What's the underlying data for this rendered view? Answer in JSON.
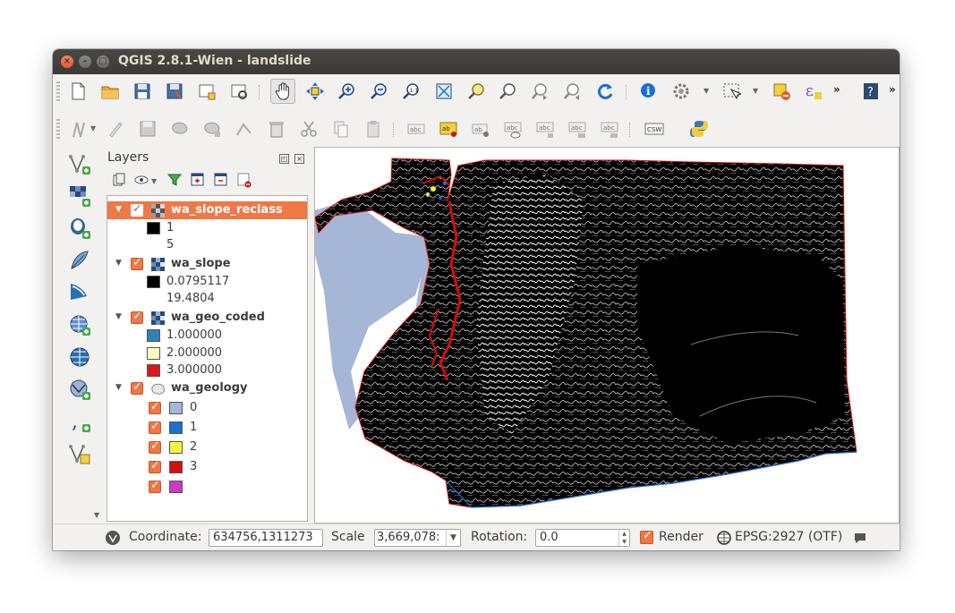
{
  "window": {
    "title": "QGIS 2.8.1-Wien - landslide"
  },
  "toolbar_icons": [
    "new-project-icon",
    "open-project-icon",
    "save-project-icon",
    "save-as-icon",
    "new-print-composer-icon",
    "composer-manager-icon",
    "pan-icon",
    "pan-to-selection-icon",
    "zoom-in-icon",
    "zoom-out-icon",
    "zoom-native-icon",
    "zoom-full-icon",
    "zoom-to-layer-icon",
    "zoom-last-icon",
    "zoom-next-icon",
    "refresh-icon",
    "identify-icon",
    "measure-icon",
    "select-icon",
    "deselect-icon",
    "epsilon-icon",
    "help-icon"
  ],
  "layers_panel": {
    "title": "Layers",
    "layers": [
      {
        "name": "wa_slope_reclass",
        "selected": true,
        "legend": [
          {
            "color": "#000000",
            "label": "1"
          },
          {
            "color": "",
            "label": "5"
          }
        ]
      },
      {
        "name": "wa_slope",
        "selected": false,
        "legend": [
          {
            "color": "#000000",
            "label": "0.0795117"
          },
          {
            "color": "",
            "label": "19.4804"
          }
        ]
      },
      {
        "name": "wa_geo_coded",
        "selected": false,
        "legend": [
          {
            "color": "#2b83ba",
            "label": "1.000000"
          },
          {
            "color": "#ffffbf",
            "label": "2.000000"
          },
          {
            "color": "#d7191c",
            "label": "3.000000"
          }
        ]
      },
      {
        "name": "wa_geology",
        "selected": false,
        "legend": [
          {
            "color": "#a6b6d6",
            "label": "0"
          },
          {
            "color": "#1a6fcf",
            "label": "1"
          },
          {
            "color": "#f4f43c",
            "label": "2"
          },
          {
            "color": "#d40d0d",
            "label": "3"
          },
          {
            "color": "#c83dc3",
            "label": ""
          }
        ]
      }
    ]
  },
  "status": {
    "coordinate_label": "Coordinate:",
    "coordinate_value": "634756,1311273",
    "scale_label": "Scale",
    "scale_value": ":3,669,078",
    "rotation_label": "Rotation:",
    "rotation_value": "0.0",
    "render_label": "Render",
    "crs": "EPSG:2927 (OTF)"
  }
}
